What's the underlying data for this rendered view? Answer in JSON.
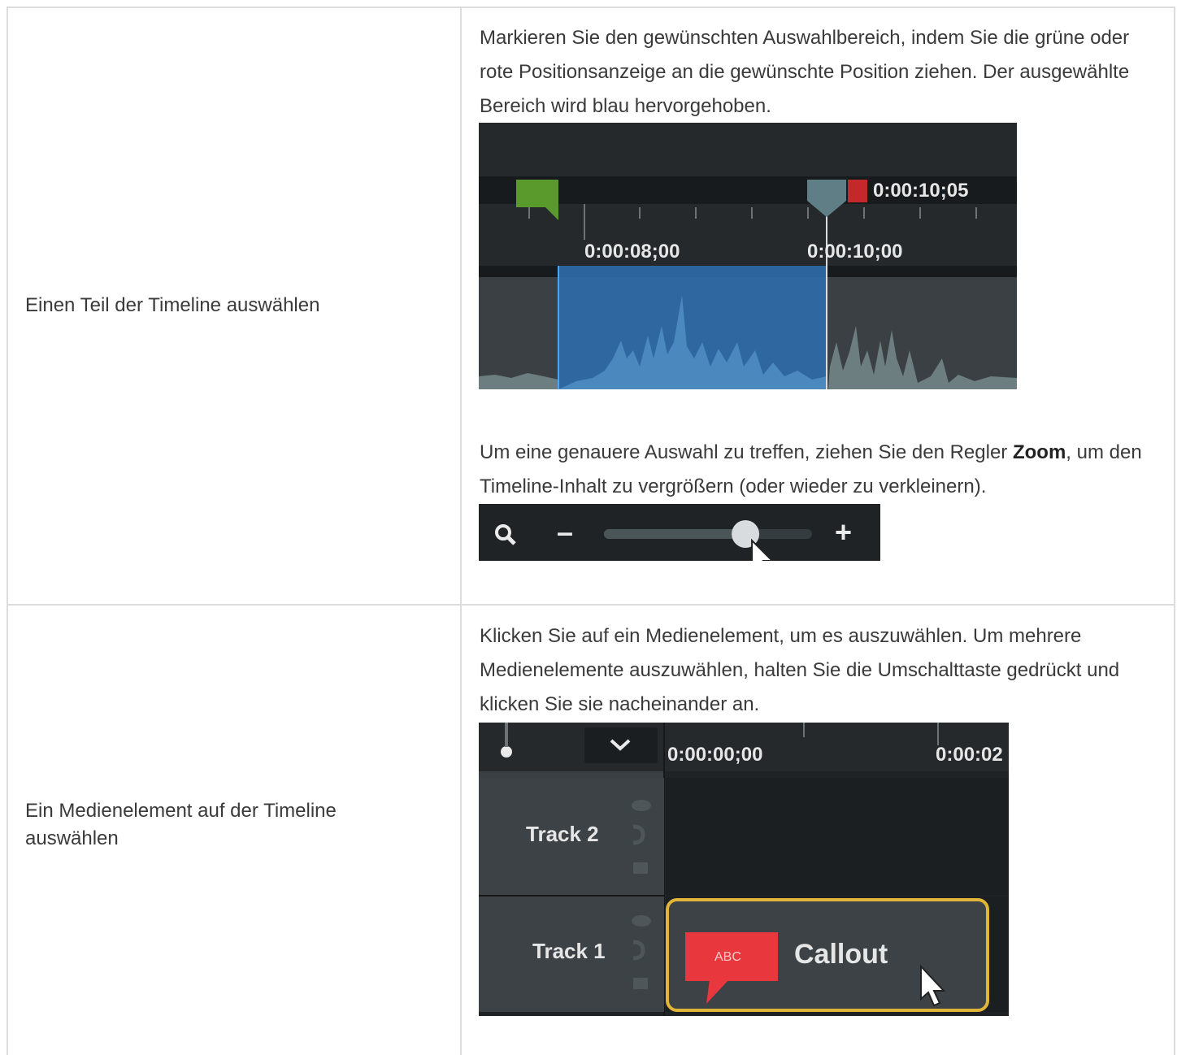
{
  "row1": {
    "label": "Einen Teil der Timeline auswählen",
    "desc1": "Markieren Sie den gewünschten Auswahlbereich, indem Sie die grüne oder rote Positionsanzeige an die gewünschte Position ziehen. Der ausgewählte Bereich wird blau hervorgehoben.",
    "desc2_pre": "Um eine genauere Auswahl zu treffen, ziehen Sie den Regler ",
    "desc2_bold": "Zoom",
    "desc2_post": ", um den Timeline-Inhalt zu vergrößern (oder wieder zu verkleinern).",
    "timeline_shot": {
      "end_time": "0:00:10;05",
      "tick_label_1": "0:00:08;00",
      "tick_label_2": "0:00:10;00"
    },
    "zoom_shot": {
      "minus": "–",
      "plus": "+",
      "level": 0.68
    }
  },
  "row2": {
    "label": "Ein Medienelement auf der Timeline auswählen",
    "desc": "Klicken Sie auf ein Medienelement, um es auszuwählen. Um mehrere Medienelemente auszuwählen, halten Sie die Umschalttaste gedrückt und klicken Sie sie nacheinander an.",
    "tracks_shot": {
      "time_1": "0:00:00;00",
      "time_2": "0:00:02",
      "track2": "Track 2",
      "track1": "Track 1",
      "callout_icon_text": "ABC",
      "callout_label": "Callout"
    }
  },
  "colors": {
    "green_marker": "#5a9a2c",
    "red_marker": "#c4282a",
    "selection_blue": "#2f6aa8",
    "callout_red": "#e8383d",
    "selected_border": "#e0b53a",
    "dark_bg": "#1f2326"
  }
}
